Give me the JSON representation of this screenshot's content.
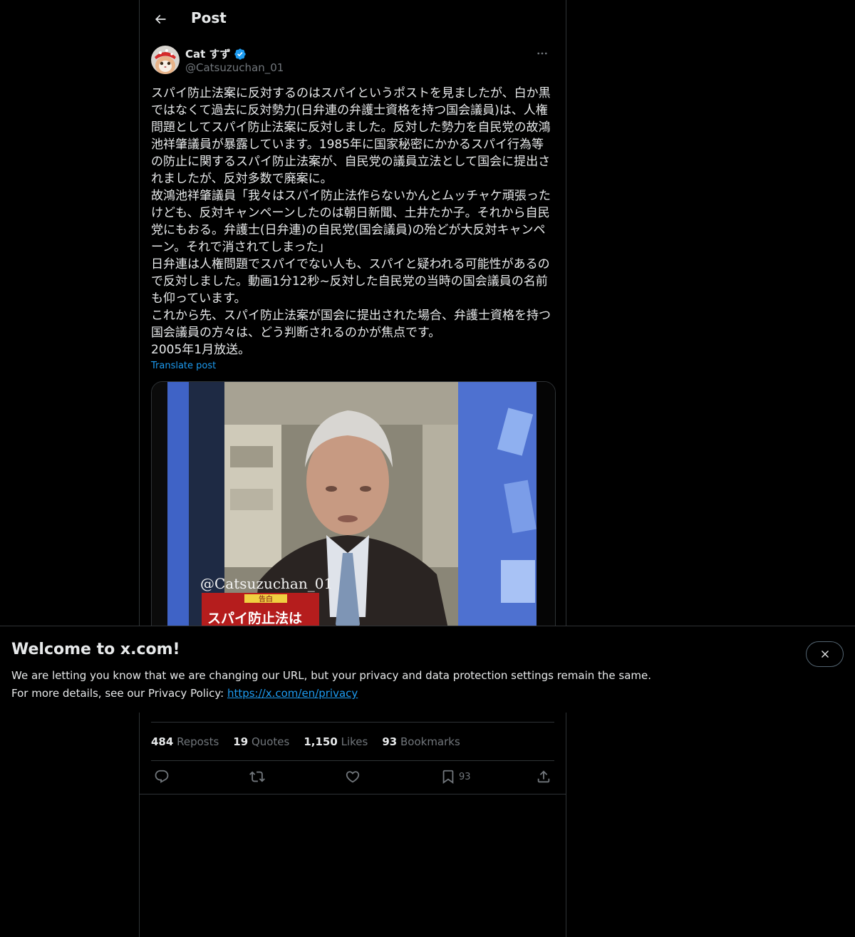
{
  "header": {
    "title": "Post"
  },
  "author": {
    "name": "Cat すず",
    "handle": "@Catsuzuchan_01",
    "verified": true
  },
  "post": {
    "text": "スパイ防止法案に反対するのはスパイというポストを見ましたが、白か黒ではなくて過去に反対勢力(日弁連の弁護士資格を持つ国会議員)は、人権問題としてスパイ防止法案に反対しました。反対した勢力を自民党の故鴻池祥肇議員が暴露しています。1985年に国家秘密にかかるスパイ行為等の防止に関するスパイ防止法案が、自民党の議員立法として国会に提出されましたが、反対多数で廃案に。\n故鴻池祥肇議員「我々はスパイ防止法作らないかんとムッチャケ頑張ったけども、反対キャンペーンしたのは朝日新聞、土井たか子。それから自民党にもおる。弁護士(日弁連)の自民党(国会議員)の殆どが大反対キャンペーン。それで消されてしまった」\n日弁連は人権問題でスパイでない人も、スパイと疑われる可能性があるので反対しました。動画1分12秒~反対した自民党の当時の国会議員の名前も仰っています。\nこれから先、スパイ防止法案が国会に提出された場合、弁護士資格を持つ国会議員の方々は、どう判断されるのかが焦点です。\n2005年1月放送。",
    "translate_label": "Translate post"
  },
  "media": {
    "watermark": "@Catsuzuchan_01",
    "caption_small": "告白",
    "caption": "スパイ防止法は"
  },
  "stats": [
    {
      "num": "484",
      "label": "Reposts"
    },
    {
      "num": "19",
      "label": "Quotes"
    },
    {
      "num": "1,150",
      "label": "Likes"
    },
    {
      "num": "93",
      "label": "Bookmarks"
    }
  ],
  "actions": {
    "bookmark_count": "93"
  },
  "banner": {
    "title": "Welcome to x.com!",
    "line1": "We are letting you know that we are changing our URL, but your privacy and data protection settings remain the same.",
    "line2_prefix": "For more details, see our Privacy Policy: ",
    "link": "https://x.com/en/privacy"
  },
  "colors": {
    "background": "#000000",
    "text": "#e7e9ea",
    "muted": "#71767b",
    "accent": "#1d9bf0",
    "border": "#2f3336"
  }
}
